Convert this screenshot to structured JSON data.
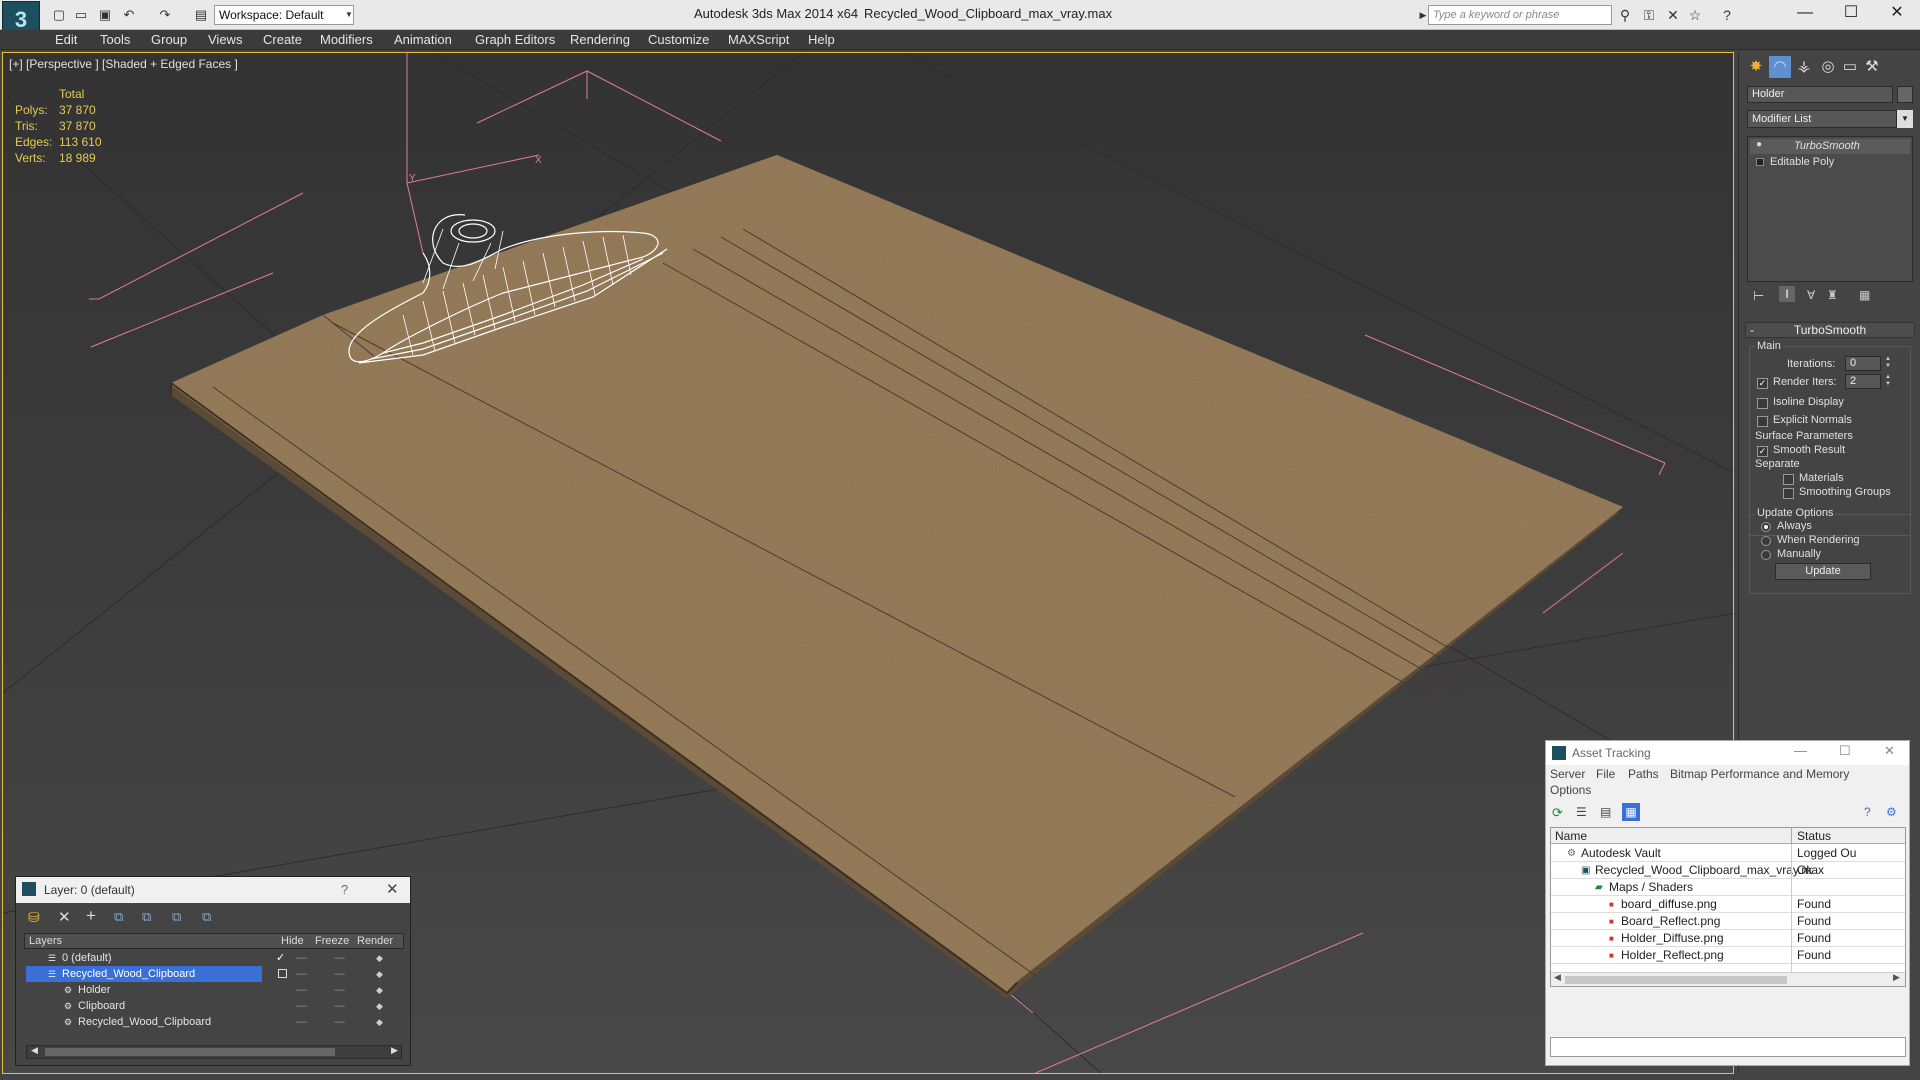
{
  "titlebar": {
    "workspace": "Workspace: Default",
    "app_title": "Autodesk 3ds Max  2014 x64",
    "file_title": "Recycled_Wood_Clipboard_max_vray.max",
    "search_placeholder": "Type a keyword or phrase"
  },
  "menu": [
    "Edit",
    "Tools",
    "Group",
    "Views",
    "Create",
    "Modifiers",
    "Animation",
    "Graph Editors",
    "Rendering",
    "Customize",
    "MAXScript",
    "Help"
  ],
  "viewport": {
    "label": "[+] [Perspective ] [Shaded + Edged Faces ]",
    "stats": {
      "header": "Total",
      "rows": [
        {
          "label": "Polys:",
          "value": "37 870"
        },
        {
          "label": "Tris:",
          "value": "37 870"
        },
        {
          "label": "Edges:",
          "value": "113 610"
        },
        {
          "label": "Verts:",
          "value": "18 989"
        }
      ]
    },
    "gizmo_labels": {
      "y": "Y",
      "x": "X"
    }
  },
  "command_panel": {
    "object_name": "Holder",
    "modifier_list": "Modifier List",
    "stack": [
      "TurboSmooth",
      "Editable Poly"
    ],
    "rollout_title": "TurboSmooth",
    "main_label": "Main",
    "iterations_label": "Iterations:",
    "iterations_value": "0",
    "render_iters_label": "Render Iters:",
    "render_iters_value": "2",
    "isoline": "Isoline Display",
    "explicit_normals": "Explicit Normals",
    "surface_params": "Surface Parameters",
    "smooth_result": "Smooth Result",
    "separate": "Separate",
    "materials": "Materials",
    "smoothing_groups": "Smoothing Groups",
    "update_options": "Update Options",
    "always": "Always",
    "when_rendering": "When Rendering",
    "manually": "Manually",
    "update_button": "Update"
  },
  "layer_window": {
    "title": "Layer: 0 (default)",
    "help": "?",
    "columns": [
      "Layers",
      "Hide",
      "Freeze",
      "Render"
    ],
    "rows": [
      "0 (default)",
      "Recycled_Wood_Clipboard",
      "Holder",
      "Clipboard",
      "Recycled_Wood_Clipboard"
    ]
  },
  "asset_tracking": {
    "title": "Asset Tracking",
    "menu": [
      "Server",
      "File",
      "Paths",
      "Bitmap Performance and Memory",
      "Options"
    ],
    "columns": [
      "Name",
      "Status"
    ],
    "rows": [
      {
        "name": "Autodesk Vault",
        "status": "Logged Ou"
      },
      {
        "name": "Recycled_Wood_Clipboard_max_vray.max",
        "status": "Ok"
      },
      {
        "name": "Maps / Shaders",
        "status": ""
      },
      {
        "name": "board_diffuse.png",
        "status": "Found"
      },
      {
        "name": "Board_Reflect.png",
        "status": "Found"
      },
      {
        "name": "Holder_Diffuse.png",
        "status": "Found"
      },
      {
        "name": "Holder_Reflect.png",
        "status": "Found"
      }
    ]
  },
  "colors": {
    "accent": "#e2c33a",
    "stats": "#e3cb58",
    "selection": "#3b6fd8",
    "gizmo": "#e27aa0"
  }
}
